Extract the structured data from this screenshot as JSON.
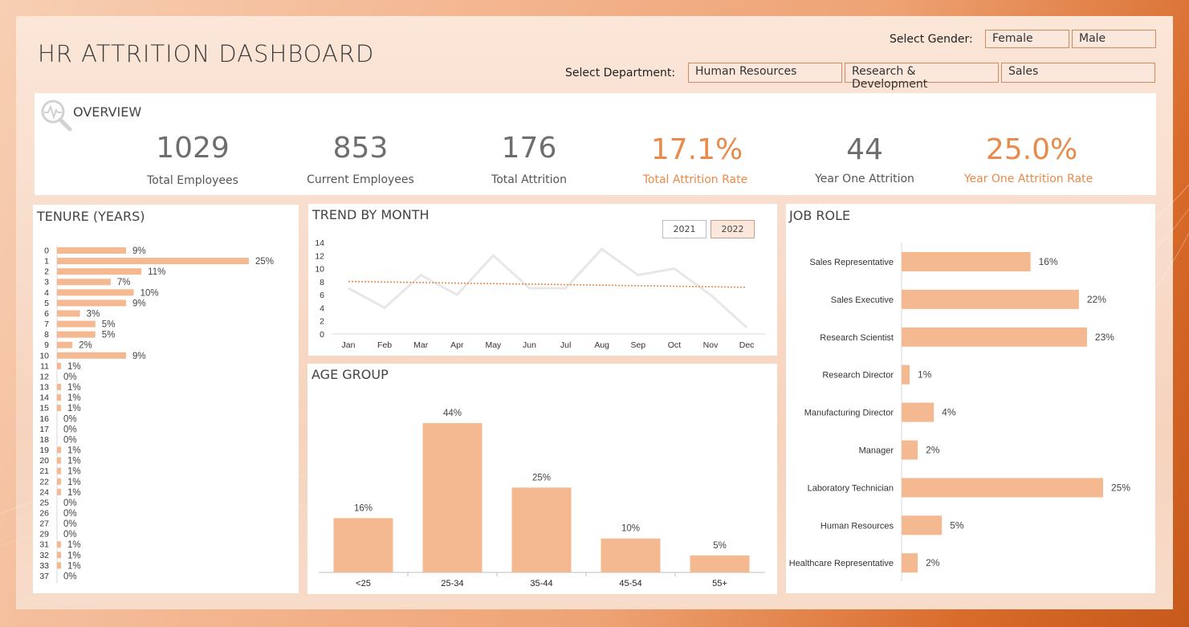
{
  "header": {
    "title": "HR ATTRITION DASHBOARD",
    "gender_label": "Select Gender:",
    "gender_options": [
      "Female",
      "Male"
    ],
    "department_label": "Select Department:",
    "department_options": [
      "Human Resources",
      "Research & Development",
      "Sales"
    ]
  },
  "overview": {
    "title": "OVERVIEW",
    "kpis": [
      {
        "value": "1029",
        "label": "Total Employees"
      },
      {
        "value": "853",
        "label": "Current Employees"
      },
      {
        "value": "176",
        "label": "Total Attrition"
      },
      {
        "value": "17.1%",
        "label": "Total Attrition Rate"
      },
      {
        "value": "44",
        "label": "Year One Attrition"
      },
      {
        "value": "25.0%",
        "label": "Year One Attrition Rate"
      }
    ]
  },
  "colors": {
    "accent": "#f4b990",
    "highlight": "#e98a4a",
    "kpi_gray": "#6e6e6e",
    "trend_line": "#e7e7e7",
    "trend_dotted": "#e98a4a"
  },
  "chart_data": [
    {
      "type": "bar",
      "title": "TENURE (YEARS)",
      "orientation": "horizontal",
      "categories": [
        "0",
        "1",
        "2",
        "3",
        "4",
        "5",
        "6",
        "7",
        "8",
        "9",
        "10",
        "11",
        "12",
        "13",
        "14",
        "15",
        "16",
        "17",
        "18",
        "19",
        "20",
        "21",
        "22",
        "24",
        "25",
        "26",
        "27",
        "29",
        "31",
        "32",
        "33",
        "37"
      ],
      "values": [
        9,
        25,
        11,
        7,
        10,
        9,
        3,
        5,
        5,
        2,
        9,
        1,
        0,
        1,
        1,
        1,
        0,
        0,
        0,
        1,
        1,
        1,
        1,
        1,
        0,
        0,
        0,
        0,
        1,
        1,
        1,
        0
      ],
      "labels": [
        "9%",
        "25%",
        "11%",
        "7%",
        "10%",
        "9%",
        "3%",
        "5%",
        "5%",
        "2%",
        "9%",
        "1%",
        "0%",
        "1%",
        "1%",
        "1%",
        "0%",
        "0%",
        "0%",
        "1%",
        "1%",
        "1%",
        "1%",
        "1%",
        "0%",
        "0%",
        "0%",
        "0%",
        "1%",
        "1%",
        "1%",
        "0%"
      ]
    },
    {
      "type": "line",
      "title": "TREND BY MONTH",
      "year_buttons": [
        "2021",
        "2022"
      ],
      "selected_year": "2022",
      "x": [
        "Jan",
        "Feb",
        "Mar",
        "Apr",
        "May",
        "Jun",
        "Jul",
        "Aug",
        "Sep",
        "Oct",
        "Nov",
        "Dec"
      ],
      "values": [
        7,
        4,
        9,
        6,
        12,
        7,
        7,
        13,
        9,
        10,
        6,
        1
      ],
      "trendline": "linear",
      "ylim": [
        0,
        14
      ],
      "yticks": [
        "0",
        "2",
        "4",
        "6",
        "8",
        "10",
        "12",
        "14"
      ]
    },
    {
      "type": "bar",
      "title": "AGE GROUP",
      "categories": [
        "<25",
        "25-34",
        "35-44",
        "45-54",
        "55+"
      ],
      "values": [
        16,
        44,
        25,
        10,
        5
      ],
      "labels": [
        "16%",
        "44%",
        "25%",
        "10%",
        "5%"
      ]
    },
    {
      "type": "bar",
      "title": "JOB ROLE",
      "orientation": "horizontal",
      "categories": [
        "Sales Representative",
        "Sales Executive",
        "Research Scientist",
        "Research Director",
        "Manufacturing Director",
        "Manager",
        "Laboratory Technician",
        "Human Resources",
        "Healthcare Representative"
      ],
      "values": [
        16,
        22,
        23,
        1,
        4,
        2,
        25,
        5,
        2
      ],
      "labels": [
        "16%",
        "22%",
        "23%",
        "1%",
        "4%",
        "2%",
        "25%",
        "5%",
        "2%"
      ]
    }
  ]
}
